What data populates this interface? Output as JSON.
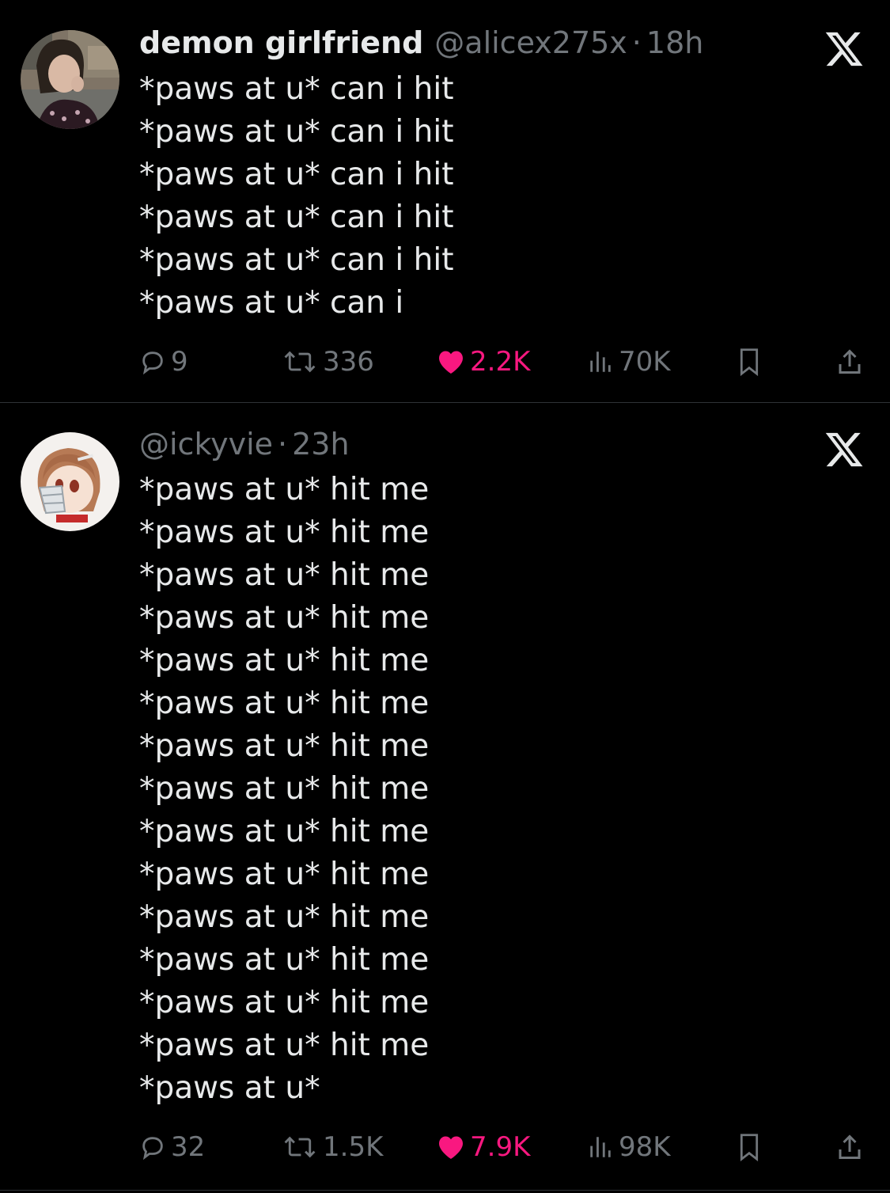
{
  "tweets": [
    {
      "author_name": "demon girlfriend",
      "handle": "@alicex275x",
      "separator": "·",
      "time": "18h",
      "lines": [
        "*paws at u* can i hit",
        "*paws at u* can i hit",
        "*paws at u* can i hit",
        "*paws at u* can i hit",
        "*paws at u* can i hit",
        "*paws at u* can i"
      ],
      "replies": "9",
      "retweets": "336",
      "likes": "2.2K",
      "views": "70K"
    },
    {
      "author_name": "",
      "handle": "@ickyvie",
      "separator": "·",
      "time": "23h",
      "lines": [
        "*paws at u* hit me",
        "*paws at u* hit me",
        "*paws at u* hit me",
        "*paws at u* hit me",
        "*paws at u* hit me",
        "*paws at u* hit me",
        "*paws at u* hit me",
        "*paws at u* hit me",
        "*paws at u* hit me",
        "*paws at u* hit me",
        "*paws at u* hit me",
        "*paws at u* hit me",
        "*paws at u* hit me",
        "*paws at u* hit me",
        "*paws at u*"
      ],
      "replies": "32",
      "retweets": "1.5K",
      "likes": "7.9K",
      "views": "98K"
    }
  ],
  "icons": [
    "x-logo-icon",
    "reply-icon",
    "retweet-icon",
    "heart-icon",
    "views-icon",
    "bookmark-icon",
    "share-icon"
  ],
  "colors": {
    "background": "#000000",
    "text": "#e7e9ea",
    "muted": "#71767b",
    "like": "#f91880",
    "divider": "#2f3336"
  }
}
